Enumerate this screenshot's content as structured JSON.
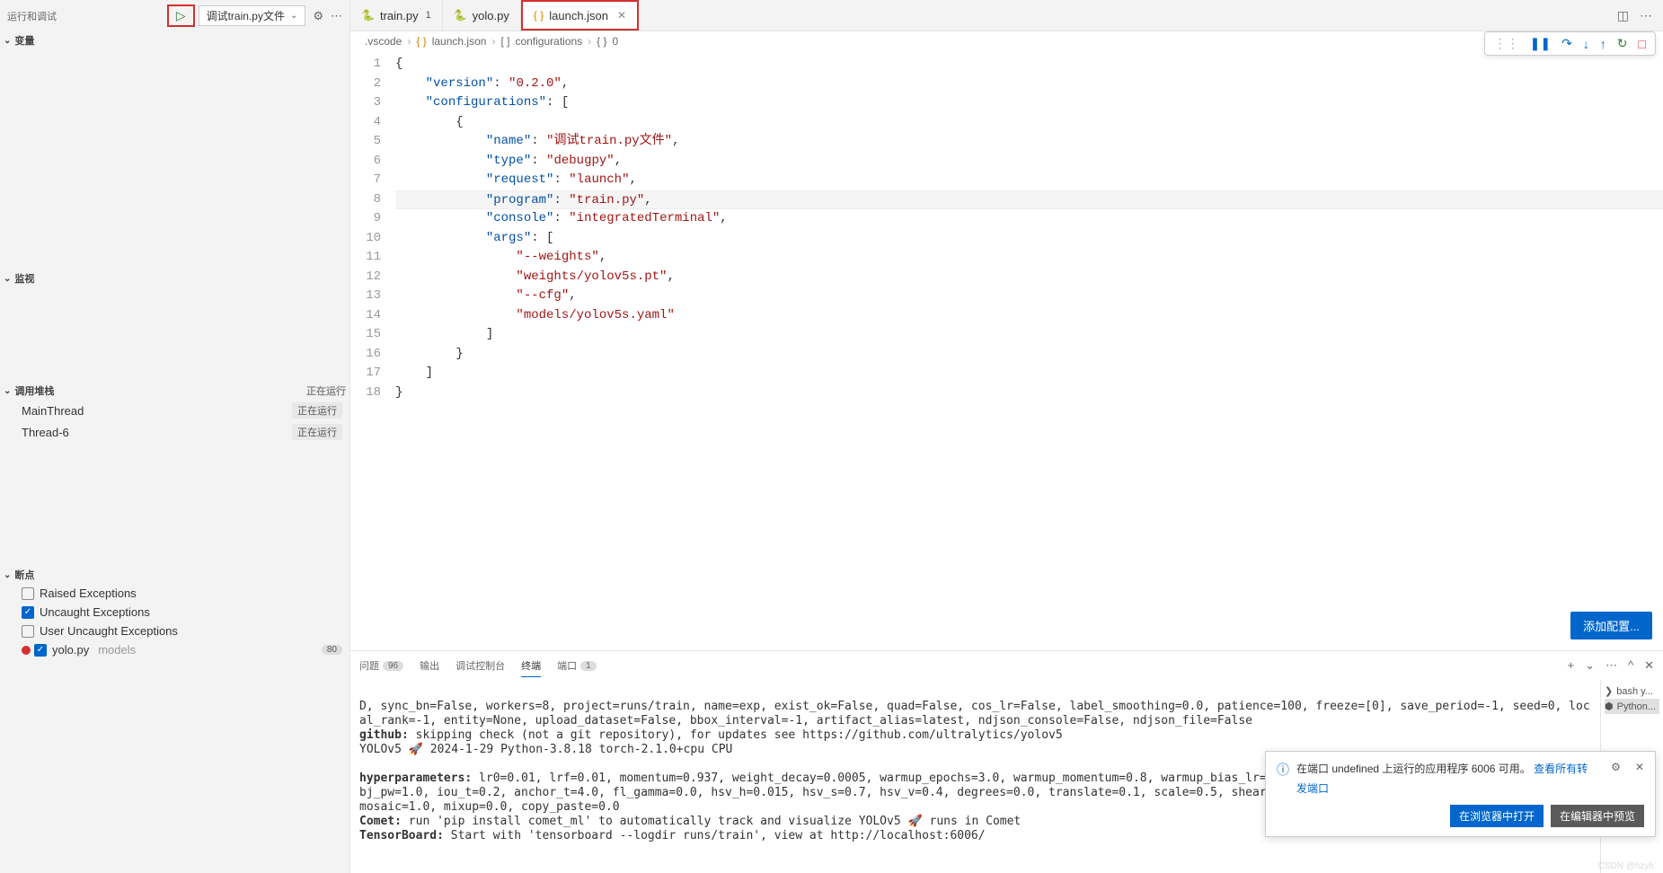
{
  "sidebar": {
    "title": "运行和调试",
    "debug_config": "调试train.py文件",
    "sections": {
      "vars": "变量",
      "watch": "监视",
      "callstack": "调用堆栈",
      "breakpoints": "断点"
    },
    "callstack_status": "正在运行",
    "threads": [
      {
        "name": "MainThread",
        "status": "正在运行"
      },
      {
        "name": "Thread-6",
        "status": "正在运行"
      }
    ],
    "breakpoints": {
      "raised": "Raised Exceptions",
      "uncaught": "Uncaught Exceptions",
      "user_uncaught": "User Uncaught Exceptions",
      "file": "yolo.py",
      "file_sub": "models",
      "count": "80"
    }
  },
  "tabs": [
    {
      "icon": "python",
      "label": "train.py",
      "modified": "1"
    },
    {
      "icon": "python",
      "label": "yolo.py"
    },
    {
      "icon": "json",
      "label": "launch.json",
      "active": true,
      "highlight": true
    }
  ],
  "breadcrumb": {
    "folder": ".vscode",
    "file": "launch.json",
    "array": "configurations",
    "obj": "0"
  },
  "editor": {
    "line_highlight": 8,
    "add_config": "添加配置...",
    "tokens": [
      [
        {
          "t": "{",
          "c": "punct"
        }
      ],
      [
        {
          "t": "    ",
          "c": ""
        },
        {
          "t": "\"version\"",
          "c": "key"
        },
        {
          "t": ": ",
          "c": "punct"
        },
        {
          "t": "\"0.2.0\"",
          "c": "string"
        },
        {
          "t": ",",
          "c": "punct"
        }
      ],
      [
        {
          "t": "    ",
          "c": ""
        },
        {
          "t": "\"configurations\"",
          "c": "key"
        },
        {
          "t": ": [",
          "c": "punct"
        }
      ],
      [
        {
          "t": "        {",
          "c": "punct"
        }
      ],
      [
        {
          "t": "            ",
          "c": ""
        },
        {
          "t": "\"name\"",
          "c": "key"
        },
        {
          "t": ": ",
          "c": "punct"
        },
        {
          "t": "\"调试train.py文件\"",
          "c": "string"
        },
        {
          "t": ",",
          "c": "punct"
        }
      ],
      [
        {
          "t": "            ",
          "c": ""
        },
        {
          "t": "\"type\"",
          "c": "key"
        },
        {
          "t": ": ",
          "c": "punct"
        },
        {
          "t": "\"debugpy\"",
          "c": "string"
        },
        {
          "t": ",",
          "c": "punct"
        }
      ],
      [
        {
          "t": "            ",
          "c": ""
        },
        {
          "t": "\"request\"",
          "c": "key"
        },
        {
          "t": ": ",
          "c": "punct"
        },
        {
          "t": "\"launch\"",
          "c": "string"
        },
        {
          "t": ",",
          "c": "punct"
        }
      ],
      [
        {
          "t": "            ",
          "c": ""
        },
        {
          "t": "\"program\"",
          "c": "key"
        },
        {
          "t": ": ",
          "c": "punct"
        },
        {
          "t": "\"train.py\"",
          "c": "string"
        },
        {
          "t": ",",
          "c": "punct"
        }
      ],
      [
        {
          "t": "            ",
          "c": ""
        },
        {
          "t": "\"console\"",
          "c": "key"
        },
        {
          "t": ": ",
          "c": "punct"
        },
        {
          "t": "\"integratedTerminal\"",
          "c": "string"
        },
        {
          "t": ",",
          "c": "punct"
        }
      ],
      [
        {
          "t": "            ",
          "c": ""
        },
        {
          "t": "\"args\"",
          "c": "key"
        },
        {
          "t": ": [",
          "c": "punct"
        }
      ],
      [
        {
          "t": "                ",
          "c": ""
        },
        {
          "t": "\"--weights\"",
          "c": "string"
        },
        {
          "t": ",",
          "c": "punct"
        }
      ],
      [
        {
          "t": "                ",
          "c": ""
        },
        {
          "t": "\"weights/yolov5s.pt\"",
          "c": "string"
        },
        {
          "t": ",",
          "c": "punct"
        }
      ],
      [
        {
          "t": "                ",
          "c": ""
        },
        {
          "t": "\"--cfg\"",
          "c": "string"
        },
        {
          "t": ",",
          "c": "punct"
        }
      ],
      [
        {
          "t": "                ",
          "c": ""
        },
        {
          "t": "\"models/yolov5s.yaml\"",
          "c": "string"
        }
      ],
      [
        {
          "t": "            ]",
          "c": "punct"
        }
      ],
      [
        {
          "t": "        }",
          "c": "punct"
        }
      ],
      [
        {
          "t": "    ]",
          "c": "punct"
        }
      ],
      [
        {
          "t": "}",
          "c": "punct"
        }
      ]
    ]
  },
  "panel": {
    "tabs": {
      "problems": "问题",
      "problems_count": "96",
      "output": "输出",
      "debug_console": "调试控制台",
      "terminal": "终端",
      "ports": "端口",
      "ports_count": "1"
    },
    "terminal": {
      "line1": "D, sync_bn=False, workers=8, project=runs/train, name=exp, exist_ok=False, quad=False, cos_lr=False, label_smoothing=0.0, patience=100, freeze=[0], save_period=-1, seed=0, local_rank=-1, entity=None, upload_dataset=False, bbox_interval=-1, artifact_alias=latest, ndjson_console=False, ndjson_file=False",
      "github_label": "github:",
      "github_text": " skipping check (not a git repository), for updates see https://github.com/ultralytics/yolov5",
      "yolo": "YOLOv5 🚀 2024-1-29 Python-3.8.18 torch-2.1.0+cpu CPU",
      "hyper_label": "hyperparameters:",
      "hyper_text": " lr0=0.01, lrf=0.01, momentum=0.937, weight_decay=0.0005, warmup_epochs=3.0, warmup_momentum=0.8, warmup_bias_lr=0.1, box=0.05, cls=0.5, cls_pw=1.0, obj=1.0, obj_pw=1.0, iou_t=0.2, anchor_t=4.0, fl_gamma=0.0, hsv_h=0.015, hsv_s=0.7, hsv_v=0.4, degrees=0.0, translate=0.1, scale=0.5, shear=0.0, perspective=0.0, flipud=0.0, fliplr=0.5, mosaic=1.0, mixup=0.0, copy_paste=0.0",
      "comet_label": "Comet:",
      "comet_text": " run 'pip install comet_ml' to automatically track and visualize YOLOv5 🚀 runs in Comet",
      "tb_label": "TensorBoard:",
      "tb_text": " Start with 'tensorboard --logdir runs/train', view at http://localhost:6006/"
    },
    "side": {
      "bash": "bash y...",
      "python": "Python..."
    }
  },
  "notification": {
    "text": "在端口 undefined 上运行的应用程序 6006 可用。",
    "link": "查看所有转",
    "sub": "发端口",
    "btn_primary": "在浏览器中打开",
    "btn_secondary": "在编辑器中预览"
  }
}
